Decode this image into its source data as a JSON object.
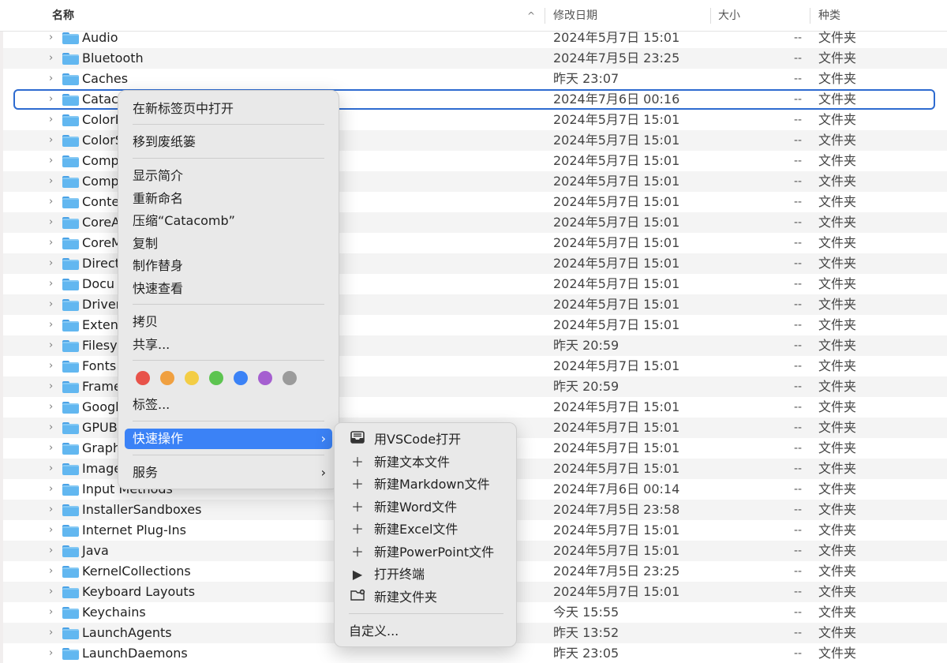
{
  "header": {
    "name": "名称",
    "sort_indicator": "^",
    "modified": "修改日期",
    "size": "大小",
    "kind": "种类"
  },
  "files": [
    {
      "name": "Audio",
      "date": "2024年5月7日 15:01",
      "size": "--",
      "kind": "文件夹"
    },
    {
      "name": "Bluetooth",
      "date": "2024年7月5日 23:25",
      "size": "--",
      "kind": "文件夹"
    },
    {
      "name": "Caches",
      "date": "昨天 23:07",
      "size": "--",
      "kind": "文件夹"
    },
    {
      "name": "Catac",
      "date": "2024年7月6日 00:16",
      "size": "--",
      "kind": "文件夹"
    },
    {
      "name": "ColorP",
      "date": "2024年5月7日 15:01",
      "size": "--",
      "kind": "文件夹"
    },
    {
      "name": "ColorS",
      "date": "2024年5月7日 15:01",
      "size": "--",
      "kind": "文件夹"
    },
    {
      "name": "Comp",
      "date": "2024年5月7日 15:01",
      "size": "--",
      "kind": "文件夹"
    },
    {
      "name": "Comp",
      "date": "2024年5月7日 15:01",
      "size": "--",
      "kind": "文件夹"
    },
    {
      "name": "Conte",
      "date": "2024年5月7日 15:01",
      "size": "--",
      "kind": "文件夹"
    },
    {
      "name": "CoreA",
      "date": "2024年5月7日 15:01",
      "size": "--",
      "kind": "文件夹"
    },
    {
      "name": "CoreM",
      "date": "2024年5月7日 15:01",
      "size": "--",
      "kind": "文件夹"
    },
    {
      "name": "Direct",
      "date": "2024年5月7日 15:01",
      "size": "--",
      "kind": "文件夹"
    },
    {
      "name": "Docu",
      "date": "2024年5月7日 15:01",
      "size": "--",
      "kind": "文件夹"
    },
    {
      "name": "Driver",
      "date": "2024年5月7日 15:01",
      "size": "--",
      "kind": "文件夹"
    },
    {
      "name": "Extens",
      "date": "2024年5月7日 15:01",
      "size": "--",
      "kind": "文件夹"
    },
    {
      "name": "Filesy",
      "date": "昨天 20:59",
      "size": "--",
      "kind": "文件夹"
    },
    {
      "name": "Fonts",
      "date": "2024年5月7日 15:01",
      "size": "--",
      "kind": "文件夹"
    },
    {
      "name": "Frame",
      "date": "昨天 20:59",
      "size": "--",
      "kind": "文件夹"
    },
    {
      "name": "Googl",
      "date": "2024年5月7日 15:01",
      "size": "--",
      "kind": "文件夹"
    },
    {
      "name": "GPUB",
      "date": "2024年5月7日 15:01",
      "size": "--",
      "kind": "文件夹"
    },
    {
      "name": "Graph",
      "date": "2024年5月7日 15:01",
      "size": "--",
      "kind": "文件夹"
    },
    {
      "name": "Image",
      "date": "2024年5月7日 15:01",
      "size": "--",
      "kind": "文件夹"
    },
    {
      "name": "Input Methods",
      "date": "2024年7月6日 00:14",
      "size": "--",
      "kind": "文件夹"
    },
    {
      "name": "InstallerSandboxes",
      "date": "2024年7月5日 23:58",
      "size": "--",
      "kind": "文件夹"
    },
    {
      "name": "Internet Plug-Ins",
      "date": "2024年5月7日 15:01",
      "size": "--",
      "kind": "文件夹"
    },
    {
      "name": "Java",
      "date": "2024年5月7日 15:01",
      "size": "--",
      "kind": "文件夹"
    },
    {
      "name": "KernelCollections",
      "date": "2024年7月5日 23:25",
      "size": "--",
      "kind": "文件夹"
    },
    {
      "name": "Keyboard Layouts",
      "date": "2024年5月7日 15:01",
      "size": "--",
      "kind": "文件夹"
    },
    {
      "name": "Keychains",
      "date": "今天 15:55",
      "size": "--",
      "kind": "文件夹"
    },
    {
      "name": "LaunchAgents",
      "date": "昨天 13:52",
      "size": "--",
      "kind": "文件夹"
    },
    {
      "name": "LaunchDaemons",
      "date": "昨天 23:05",
      "size": "--",
      "kind": "文件夹"
    }
  ],
  "selected_index": 3,
  "context_menu": {
    "open_new_tab": "在新标签页中打开",
    "move_to_trash": "移到废纸篓",
    "get_info": "显示简介",
    "rename": "重新命名",
    "compress": "压缩“Catacomb”",
    "duplicate": "复制",
    "make_alias": "制作替身",
    "quick_look": "快速查看",
    "copy": "拷贝",
    "share": "共享...",
    "tags": "标签...",
    "quick_actions": "快速操作",
    "services": "服务",
    "arrow": "›",
    "tag_colors": [
      "#e8534a",
      "#f0a040",
      "#f3cd45",
      "#5dc450",
      "#3b82f6",
      "#a55fd0",
      "#9b9b9b"
    ]
  },
  "submenu": {
    "open_vscode": "用VSCode打开",
    "new_text": "新建文本文件",
    "new_markdown": "新建Markdown文件",
    "new_word": "新建Word文件",
    "new_excel": "新建Excel文件",
    "new_ppt": "新建PowerPoint文件",
    "open_terminal": "打开终端",
    "new_folder": "新建文件夹",
    "customize": "自定义..."
  },
  "colors": {
    "selection_border": "#2e6bd0",
    "menu_highlight": "#3b82f6",
    "folder": "#62b7f0"
  }
}
